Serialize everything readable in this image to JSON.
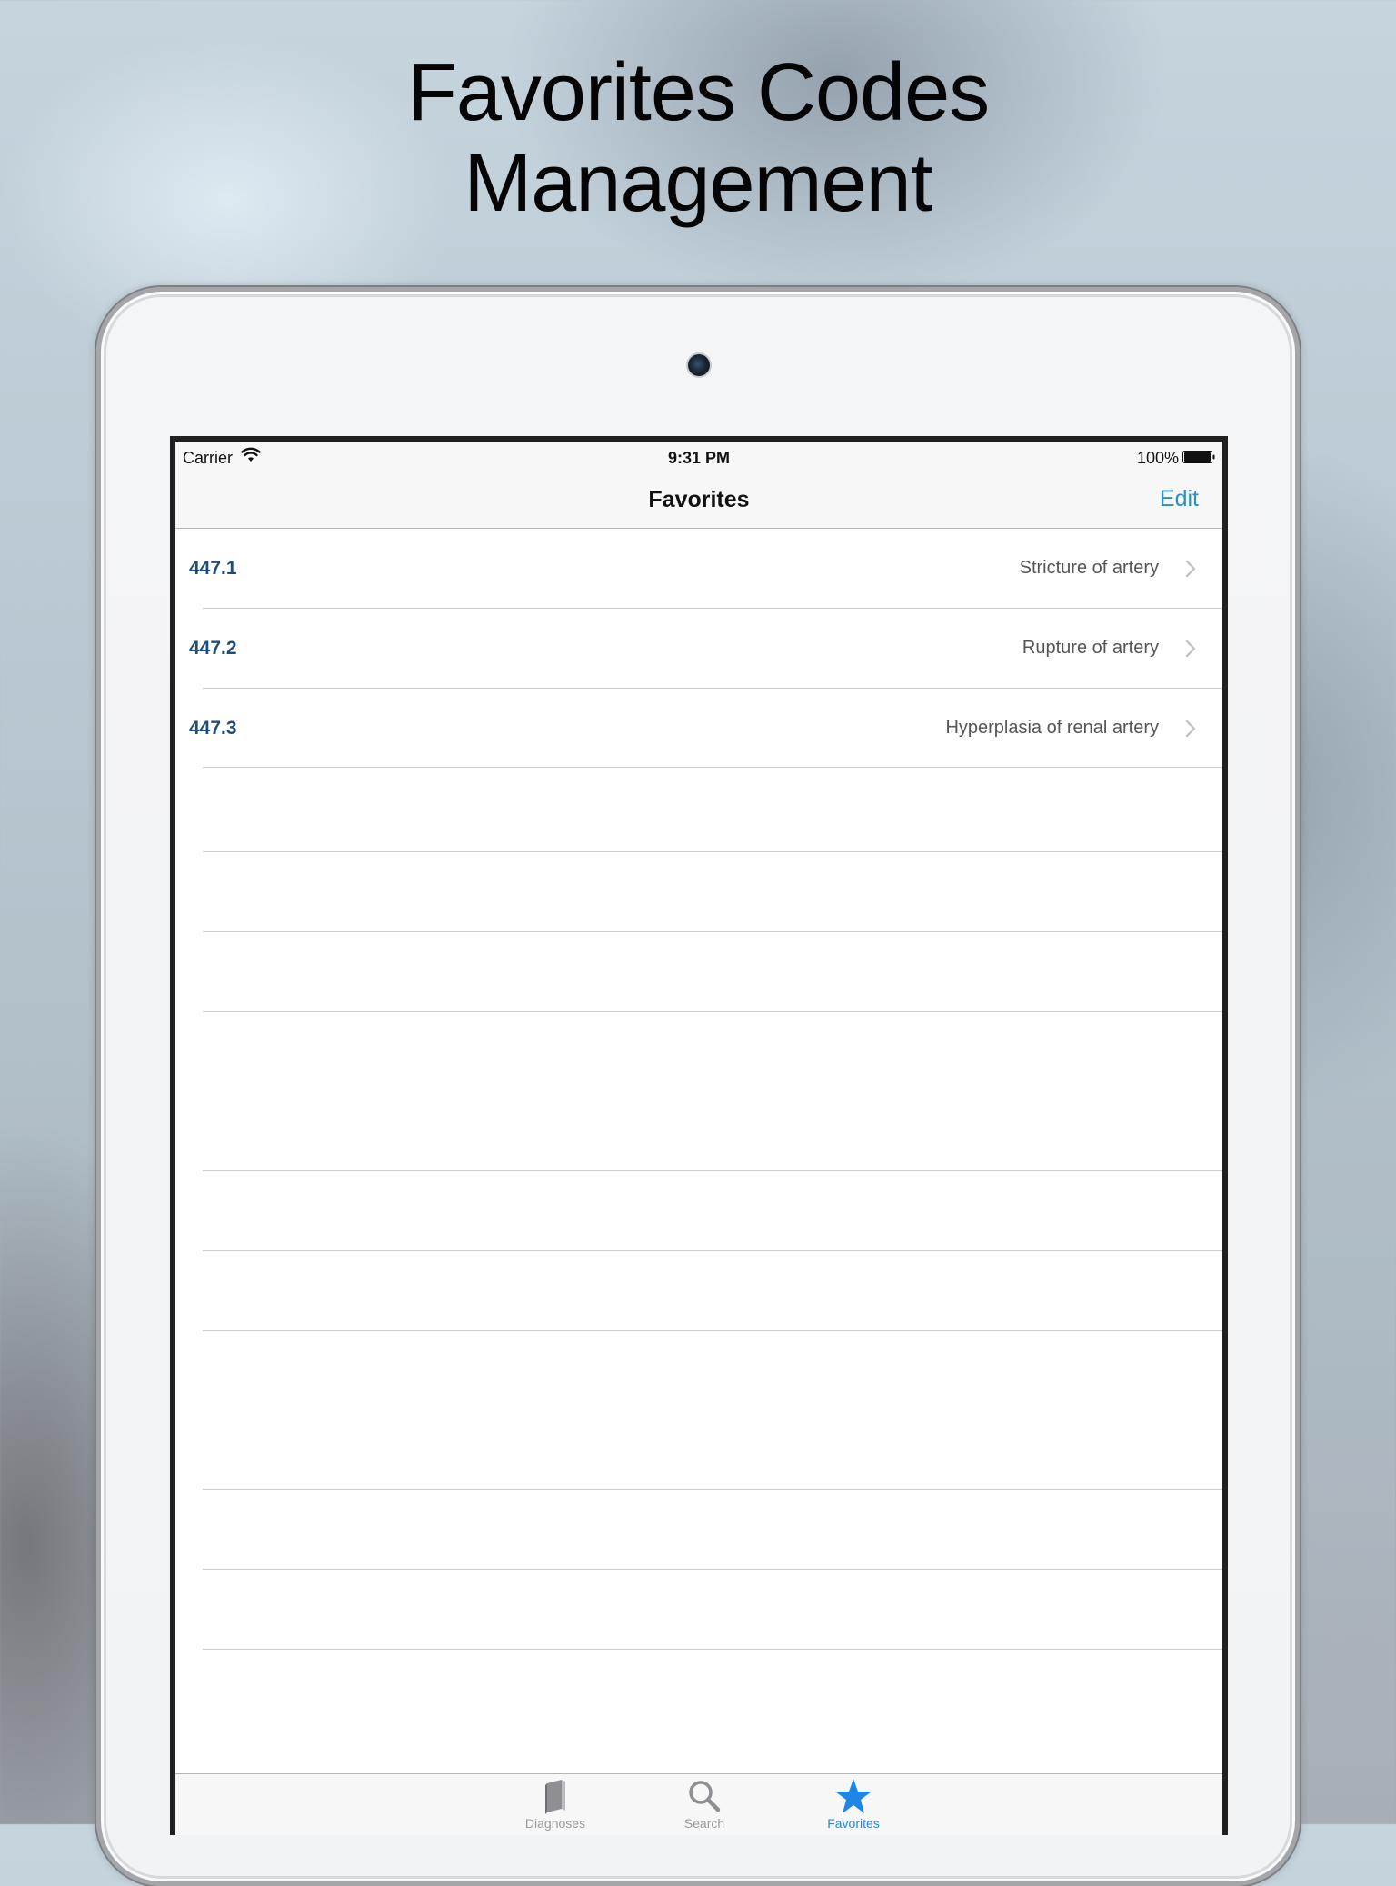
{
  "headline": {
    "line1": "Favorites Codes",
    "line2": "Management"
  },
  "status_bar": {
    "carrier": "Carrier",
    "time": "9:31 PM",
    "battery": "100%"
  },
  "nav": {
    "title": "Favorites",
    "edit_label": "Edit"
  },
  "favorites": [
    {
      "code": "447.1",
      "description": "Stricture of artery"
    },
    {
      "code": "447.2",
      "description": "Rupture of artery"
    },
    {
      "code": "447.3",
      "description": "Hyperplasia of renal artery"
    }
  ],
  "tab_bar": {
    "tabs": [
      {
        "label": "Diagnoses",
        "icon": "book-icon",
        "active": false
      },
      {
        "label": "Search",
        "icon": "search-icon",
        "active": false
      },
      {
        "label": "Favorites",
        "icon": "star-icon",
        "active": true
      }
    ]
  },
  "colors": {
    "accent": "#2f8fbf",
    "code_text": "#1f4d7a",
    "active_tab": "#1f86e8"
  }
}
